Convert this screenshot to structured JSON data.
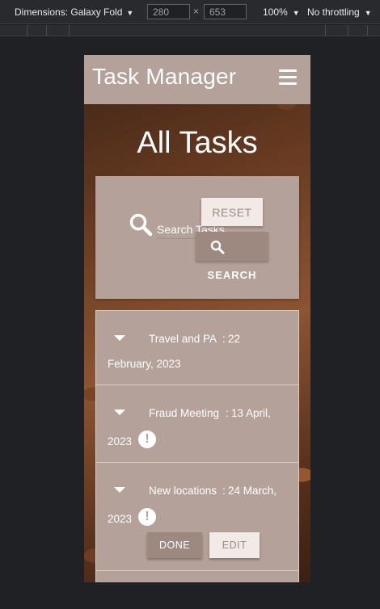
{
  "devtools": {
    "dimensions_label": "Dimensions: Galaxy Fold",
    "width": "280",
    "height": "653",
    "times": "×",
    "zoom": "100%",
    "throttling": "No throttling",
    "caret": "▼"
  },
  "app": {
    "brand": "Task Manager",
    "page_title": "All Tasks"
  },
  "search": {
    "placeholder": "Search Tasks",
    "reset_label": "RESET",
    "search_label": "SEARCH"
  },
  "tasks": [
    {
      "name": "Travel and PA",
      "sep": ":",
      "date_part1": "22",
      "date_part2": "February, 2023",
      "urgent": false
    },
    {
      "name": "Fraud Meeting",
      "sep": ":",
      "date_part1": "13 April,",
      "date_part2": "2023",
      "urgent": true,
      "alert_symbol": "!"
    },
    {
      "name": "New locations",
      "sep": ":",
      "date_part1": "24 March,",
      "date_part2": "2023",
      "urgent": true,
      "alert_symbol": "!",
      "done_label": "DONE",
      "edit_label": "EDIT"
    }
  ],
  "colors": {
    "primary": "#b4a199",
    "button_dark": "#9d8980",
    "button_light": "#f1eae7"
  }
}
